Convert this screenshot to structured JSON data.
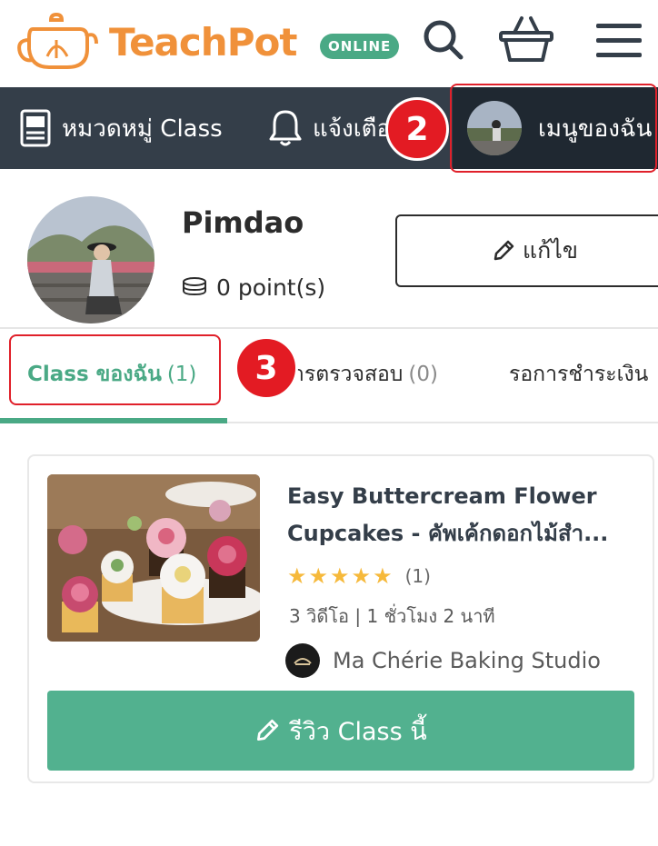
{
  "header": {
    "brand_teach": "Teach",
    "brand_pot": "Pot",
    "online_badge": "ONLINE"
  },
  "nav": {
    "categories_label": "หมวดหมู่ Class",
    "notifications_label": "แจ้งเตือ",
    "my_menu_label": "เมนูของฉัน"
  },
  "annotations": {
    "step_2": "2",
    "step_3": "3"
  },
  "profile": {
    "name": "Pimdao",
    "points": "0 point(s)",
    "edit_label": "แก้ไข"
  },
  "tabs": [
    {
      "label": "Class ของฉัน",
      "count": "(1)"
    },
    {
      "label": "ารตรวจสอบ",
      "count": "(0)"
    },
    {
      "label": "รอการชำระเงิน",
      "count": ""
    }
  ],
  "course": {
    "title_line1": "Easy Buttercream Flower",
    "title_line2": "Cupcakes - คัพเค้กดอกไม้สำ...",
    "stars": 5,
    "rating_count": "(1)",
    "meta": "3 วิดีโอ | 1 ชั่วโมง 2 นาที",
    "studio": "Ma Chérie Baking Studio",
    "review_label": "รีวิว Class นี้"
  },
  "colors": {
    "brand_orange": "#f0913a",
    "accent_green": "#4aa985",
    "navbar_bg": "#343e49",
    "annotation_red": "#e31b23"
  }
}
